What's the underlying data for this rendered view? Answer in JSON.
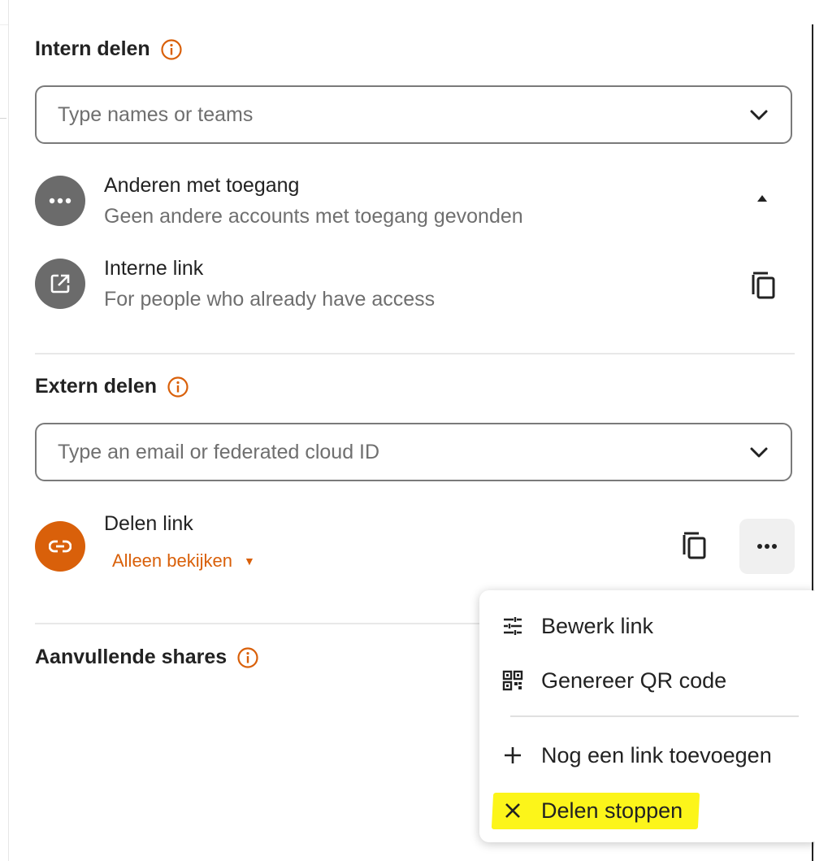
{
  "internal": {
    "heading": "Intern delen",
    "search_placeholder": "Type names or teams",
    "others": {
      "title": "Anderen met toegang",
      "subtitle": "Geen andere accounts met toegang gevonden"
    },
    "internal_link": {
      "title": "Interne link",
      "subtitle": "For people who already have access"
    }
  },
  "external": {
    "heading": "Extern delen",
    "search_placeholder": "Type an email or federated cloud ID",
    "share_link": {
      "title": "Delen link",
      "permission": "Alleen bekijken"
    }
  },
  "additional": {
    "heading": "Aanvullende shares"
  },
  "menu": {
    "items": [
      {
        "label": "Bewerk link",
        "icon": "tune-icon"
      },
      {
        "label": "Genereer QR code",
        "icon": "qr-code-icon"
      },
      {
        "label": "Nog een link toevoegen",
        "icon": "plus-icon"
      },
      {
        "label": "Delen stoppen",
        "icon": "close-icon"
      }
    ]
  },
  "colors": {
    "accent": "#d9600a",
    "avatar_grey": "#6b6b6b",
    "highlight": "#fcf51a"
  }
}
